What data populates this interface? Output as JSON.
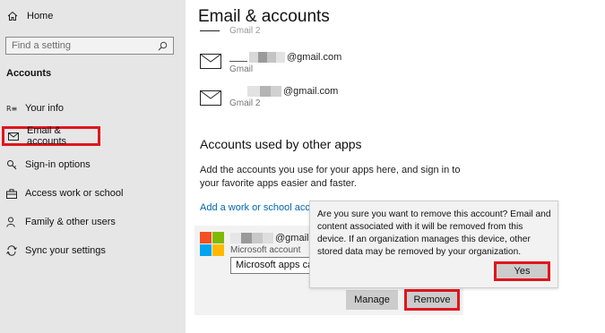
{
  "sidebar": {
    "home_label": "Home",
    "search_placeholder": "Find a setting",
    "section_title": "Accounts",
    "items": [
      {
        "label": "Your info",
        "icon": "person-card-icon"
      },
      {
        "label": "Email & accounts",
        "icon": "mail-icon"
      },
      {
        "label": "Sign-in options",
        "icon": "key-icon"
      },
      {
        "label": "Access work or school",
        "icon": "briefcase-icon"
      },
      {
        "label": "Family & other users",
        "icon": "person-add-icon"
      },
      {
        "label": "Sync your settings",
        "icon": "sync-icon"
      }
    ],
    "active_index": 1
  },
  "main": {
    "title": "Email & accounts",
    "accounts": [
      {
        "email_suffix": "@gmail.com",
        "label": "Gmail"
      },
      {
        "email_suffix": "@gmail.com",
        "label": "Gmail 2"
      }
    ],
    "partial_top_label": "Gmail 2",
    "other_apps": {
      "heading": "Accounts used by other apps",
      "description": "Add the accounts you use for your apps here, and sign in to your favorite apps easier and faster.",
      "add_link": "Add a work or school accou",
      "card": {
        "email_suffix": "@gmail",
        "account_type": "Microsoft account",
        "select_value": "Microsoft apps can"
      }
    },
    "buttons": {
      "manage": "Manage",
      "remove": "Remove"
    }
  },
  "dialog": {
    "message": "Are you sure you want to remove this account? Email and content associated with it will be removed from this device. If an organization manages this device, other stored data may be removed by your organization.",
    "yes_label": "Yes"
  },
  "colors": {
    "highlight": "#e0161d",
    "link": "#0066b4",
    "sidebar_bg": "#e6e6e6"
  }
}
